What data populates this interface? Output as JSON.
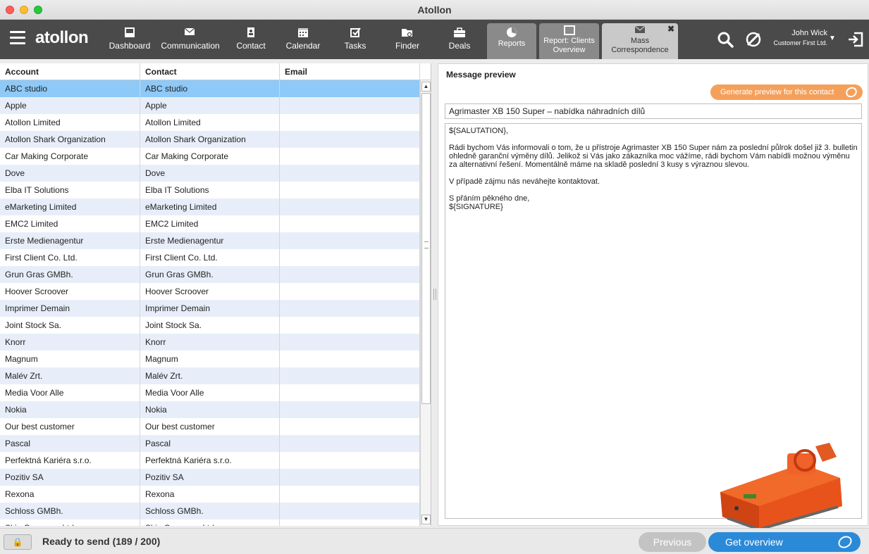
{
  "window": {
    "title": "Atollon"
  },
  "toolbar": {
    "logo": "atollon",
    "nav": [
      {
        "label": "Dashboard",
        "icon": "dashboard-icon"
      },
      {
        "label": "Communication",
        "icon": "envelope-icon"
      },
      {
        "label": "Contact",
        "icon": "contact-book-icon"
      },
      {
        "label": "Calendar",
        "icon": "calendar-icon"
      },
      {
        "label": "Tasks",
        "icon": "checkbox-icon"
      },
      {
        "label": "Finder",
        "icon": "folder-search-icon"
      },
      {
        "label": "Deals",
        "icon": "briefcase-icon"
      }
    ],
    "tabs": [
      {
        "label": "Reports",
        "icon": "pie-chart-icon"
      },
      {
        "label": "Report: Clients Overview",
        "line1": "Report: Clients",
        "line2": "Overview",
        "icon": "window-icon"
      },
      {
        "label": "Mass Correspondence",
        "line1": "Mass",
        "line2": "Correspondence",
        "icon": "mass-mail-icon",
        "close": "✖"
      }
    ],
    "user": {
      "name": "John Wick",
      "company": "Customer First Ltd."
    }
  },
  "table": {
    "columns": [
      "Account",
      "Contact",
      "Email"
    ],
    "rows": [
      {
        "account": "ABC studio",
        "contact": "ABC studio",
        "email": ""
      },
      {
        "account": "Apple",
        "contact": "Apple",
        "email": ""
      },
      {
        "account": "Atollon Limited",
        "contact": "Atollon Limited",
        "email": ""
      },
      {
        "account": "Atollon Shark Organization",
        "contact": "Atollon Shark Organization",
        "email": ""
      },
      {
        "account": "Car Making Corporate",
        "contact": "Car Making Corporate",
        "email": ""
      },
      {
        "account": "Dove",
        "contact": "Dove",
        "email": ""
      },
      {
        "account": "Elba IT Solutions",
        "contact": "Elba IT Solutions",
        "email": ""
      },
      {
        "account": "eMarketing Limited",
        "contact": "eMarketing Limited",
        "email": ""
      },
      {
        "account": "EMC2 Limited",
        "contact": "EMC2 Limited",
        "email": ""
      },
      {
        "account": "Erste Medienagentur",
        "contact": "Erste Medienagentur",
        "email": ""
      },
      {
        "account": "First Client Co. Ltd.",
        "contact": "First Client Co. Ltd.",
        "email": ""
      },
      {
        "account": "Grun Gras GMBh.",
        "contact": "Grun Gras GMBh.",
        "email": ""
      },
      {
        "account": "Hoover Scroover",
        "contact": "Hoover Scroover",
        "email": ""
      },
      {
        "account": "Imprimer Demain",
        "contact": "Imprimer Demain",
        "email": ""
      },
      {
        "account": "Joint Stock Sa.",
        "contact": "Joint Stock Sa.",
        "email": ""
      },
      {
        "account": "Knorr",
        "contact": "Knorr",
        "email": ""
      },
      {
        "account": "Magnum",
        "contact": "Magnum",
        "email": ""
      },
      {
        "account": "Malév Zrt.",
        "contact": "Malév Zrt.",
        "email": ""
      },
      {
        "account": "Media Voor Alle",
        "contact": "Media Voor Alle",
        "email": ""
      },
      {
        "account": "Nokia",
        "contact": "Nokia",
        "email": ""
      },
      {
        "account": "Our best customer",
        "contact": "Our best customer",
        "email": ""
      },
      {
        "account": "Pascal",
        "contact": "Pascal",
        "email": ""
      },
      {
        "account": "Perfektná Kariéra s.r.o.",
        "contact": "Perfektná Kariéra s.r.o.",
        "email": ""
      },
      {
        "account": "Pozitiv SA",
        "contact": "Pozitiv SA",
        "email": ""
      },
      {
        "account": "Rexona",
        "contact": "Rexona",
        "email": ""
      },
      {
        "account": "Schloss GMBh.",
        "contact": "Schloss GMBh.",
        "email": ""
      },
      {
        "account": "Skin Company Ltd.",
        "contact": "Skin Company Ltd.",
        "email": ""
      }
    ],
    "selected_row": 0
  },
  "preview": {
    "title": "Message preview",
    "generate_button": "Generate preview for this contact",
    "subject": "Agrimaster XB 150 Super – nabídka náhradních dílů",
    "body": {
      "salutation": "${SALUTATION},",
      "paragraph1": "Rádi bychom Vás informovali o tom, že u přístroje Agrimaster XB 150 Super nám za poslední půlrok došel již 3. bulletin ohledně garanční výměny dílů. Jelikož si Vás jako zákazníka moc vážíme, rádi bychom Vám nabídli možnou výměnu za alternativní řešení. Momentálně máme na skladě poslední 3 kusy s výraznou slevou.",
      "paragraph2": "V případě zájmu nás neváhejte kontaktovat.",
      "closing": "S přáním pěkného dne,",
      "signature": "${SIGNATURE}"
    },
    "image": "orange-flail-mower-image"
  },
  "statusbar": {
    "lock_icon": "lock-icon",
    "status": "Ready to send (189 / 200)",
    "previous": "Previous",
    "get_overview": "Get overview"
  },
  "colors": {
    "toolbar": "#4a4a4a",
    "selected_row": "#8ec9f7",
    "generate_button": "#f5a05a",
    "primary_button": "#2b8ad8"
  }
}
